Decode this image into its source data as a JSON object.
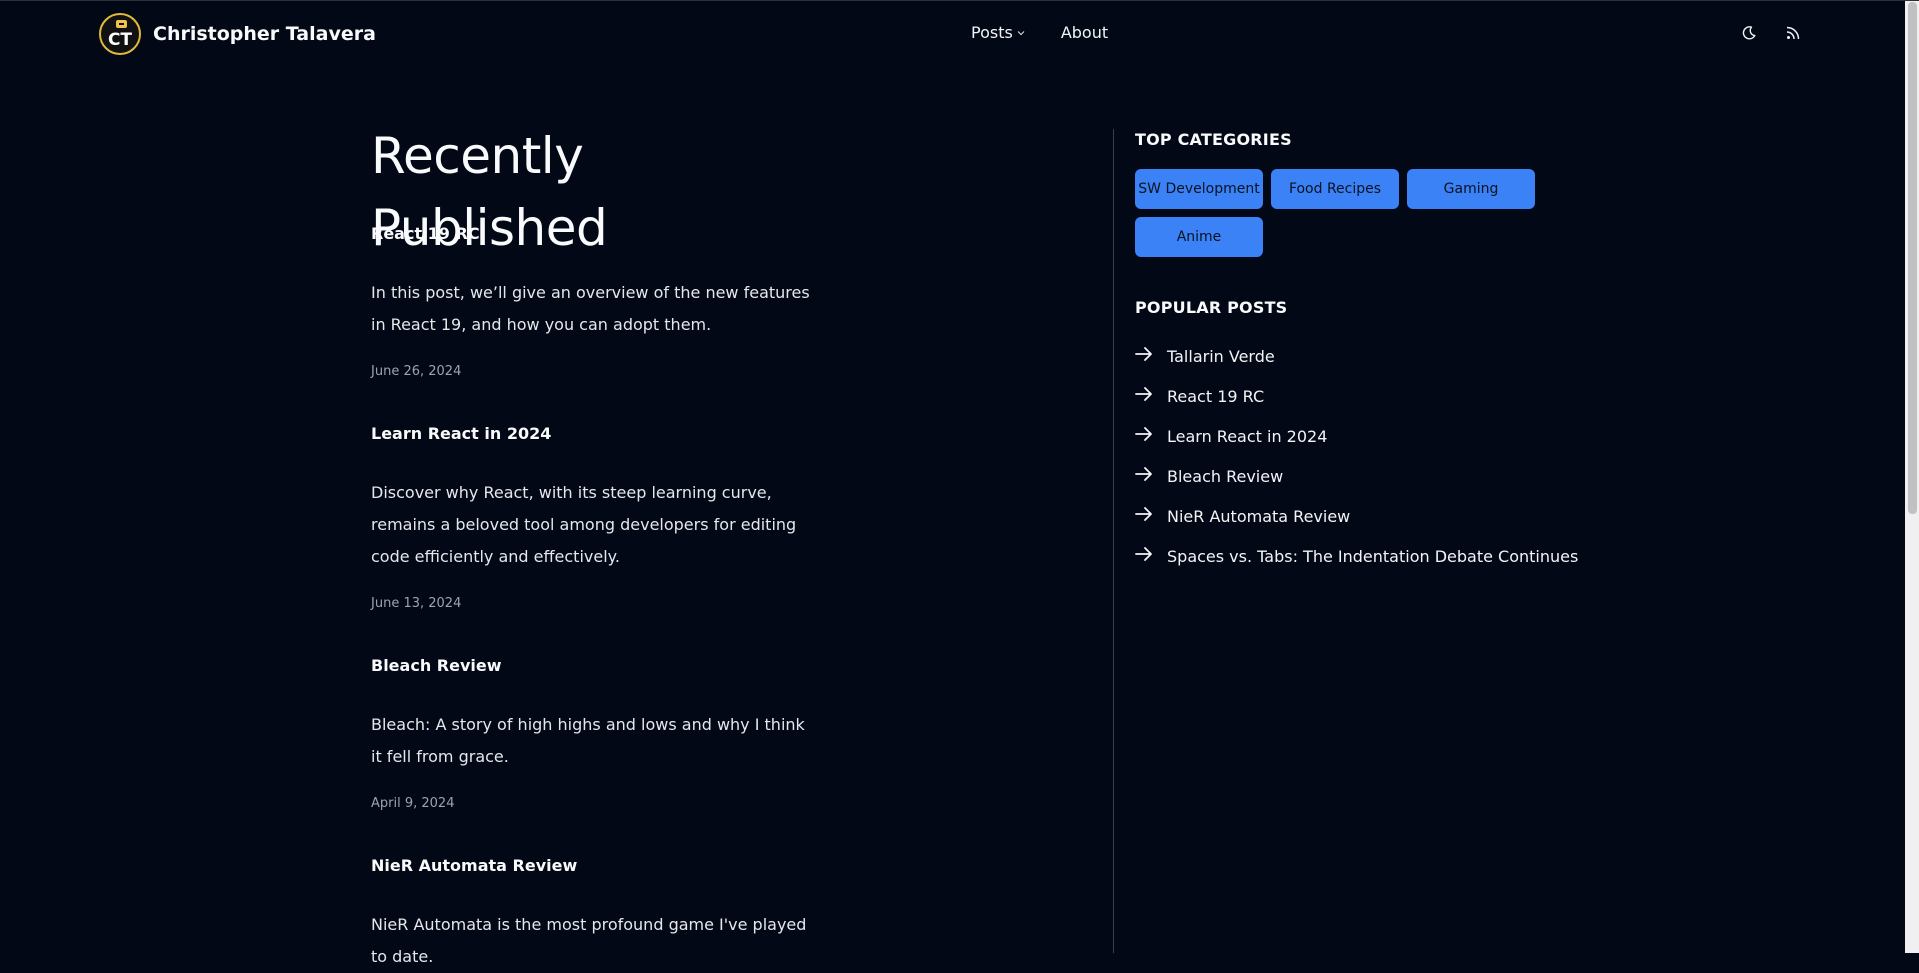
{
  "site": {
    "logo_text": "CT",
    "name": "Christopher Talavera"
  },
  "nav": {
    "posts_label": "Posts",
    "about_label": "About"
  },
  "icons": {
    "theme_toggle": "moon-icon",
    "rss": "rss-icon",
    "dropdown": "chevron-down-icon",
    "arrow": "arrow-right-icon"
  },
  "colors": {
    "background": "#030816",
    "accent": "#3b82f6",
    "text": "#f3f4f6",
    "muted": "#9ca3af"
  },
  "main": {
    "title": "Recently Published",
    "posts": [
      {
        "title": "React 19 RC",
        "excerpt": "In this post, we’ll give an overview of the new features in React 19, and how you can adopt them.",
        "date": "June 26, 2024"
      },
      {
        "title": "Learn React in 2024",
        "excerpt": "Discover why React, with its steep learning curve, remains a beloved tool among developers for editing code efficiently and effectively.",
        "date": "June 13, 2024"
      },
      {
        "title": "Bleach Review",
        "excerpt": "Bleach: A story of high highs and lows and why I think it fell from grace.",
        "date": "April 9, 2024"
      },
      {
        "title": "NieR Automata Review",
        "excerpt": "NieR Automata is the most profound game I've played to date."
      }
    ]
  },
  "sidebar": {
    "categories_heading": "TOP CATEGORIES",
    "categories": [
      "SW Development",
      "Food Recipes",
      "Gaming",
      "Anime"
    ],
    "popular_heading": "POPULAR POSTS",
    "popular": [
      "Tallarin Verde",
      "React 19 RC",
      "Learn React in 2024",
      "Bleach Review",
      "NieR Automata Review",
      "Spaces vs. Tabs: The Indentation Debate Continues"
    ]
  }
}
